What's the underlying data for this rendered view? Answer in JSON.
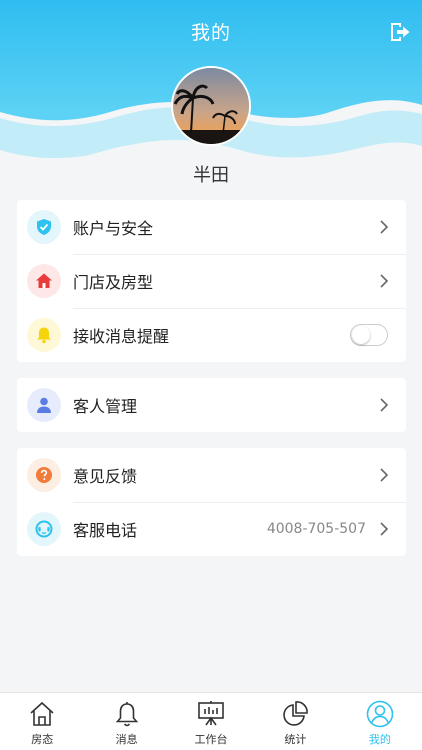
{
  "header": {
    "title": "我的"
  },
  "profile": {
    "name": "半田"
  },
  "groups": [
    {
      "items": [
        {
          "label": "账户与安全",
          "icon": "shield-check-icon",
          "icon_bg": "#e3f6fb",
          "icon_color": "#2ec2ee"
        },
        {
          "label": "门店及房型",
          "icon": "home-icon",
          "icon_bg": "#fde7e7",
          "icon_color": "#ea3b3b"
        },
        {
          "label": "接收消息提醒",
          "icon": "bell-icon",
          "icon_bg": "#fff8d6",
          "icon_color": "#f5d40c",
          "toggle": false
        }
      ]
    },
    {
      "items": [
        {
          "label": "客人管理",
          "icon": "user-icon",
          "icon_bg": "#e6ecfb",
          "icon_color": "#5b7de3"
        }
      ]
    },
    {
      "items": [
        {
          "label": "意见反馈",
          "icon": "help-icon",
          "icon_bg": "#fdeee3",
          "icon_color": "#f07b3a"
        },
        {
          "label": "客服电话",
          "icon": "service-icon",
          "icon_bg": "#e2f6fb",
          "icon_color": "#2ec2ee",
          "value": "4008-705-507"
        }
      ]
    }
  ],
  "tabbar": {
    "items": [
      {
        "label": "房态",
        "icon": "house-icon"
      },
      {
        "label": "消息",
        "icon": "bell-icon"
      },
      {
        "label": "工作台",
        "icon": "easel-icon"
      },
      {
        "label": "统计",
        "icon": "pie-chart-icon"
      },
      {
        "label": "我的",
        "icon": "profile-icon",
        "active": true
      }
    ],
    "active_color": "#2ec2ee"
  },
  "colors": {
    "accent": "#2ec2ee",
    "background": "#f4f5f7"
  }
}
